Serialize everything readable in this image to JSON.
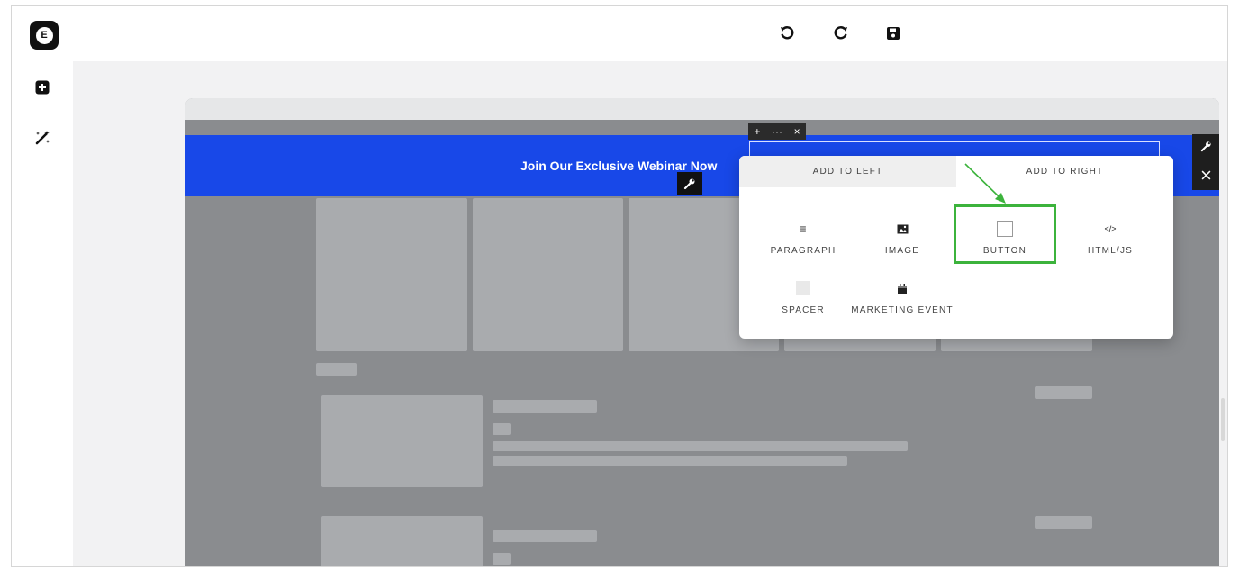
{
  "app": {
    "logo_glyph": "E",
    "logo_icon": "elementor-logo-icon"
  },
  "toolbar": {
    "undo_icon": "undo-icon",
    "redo_icon": "redo-icon",
    "save_icon": "save-icon"
  },
  "sidebar": {
    "add_icon": "plus-square-icon",
    "magic_icon": "magic-wand-icon"
  },
  "banner": {
    "text": "Join Our Exclusive Webinar Now",
    "color": "#1848e8",
    "mini_toolbar": [
      "+",
      "···",
      "×"
    ]
  },
  "popup": {
    "tabs": [
      {
        "label": "ADD TO LEFT",
        "active": true
      },
      {
        "label": "ADD TO RIGHT",
        "active": false
      }
    ],
    "options": [
      {
        "label": "PARAGRAPH",
        "icon": "paragraph-icon",
        "glyph": "≡"
      },
      {
        "label": "IMAGE",
        "icon": "image-icon",
        "glyph": ""
      },
      {
        "label": "BUTTON",
        "icon": "button-square-icon",
        "glyph": ""
      },
      {
        "label": "HTML/JS",
        "icon": "code-icon",
        "glyph": "</>"
      },
      {
        "label": "SPACER",
        "icon": "spacer-icon",
        "glyph": ""
      },
      {
        "label": "MARKETING EVENT",
        "icon": "calendar-icon",
        "glyph": ""
      }
    ],
    "highlight_color": "#3cb33c"
  }
}
